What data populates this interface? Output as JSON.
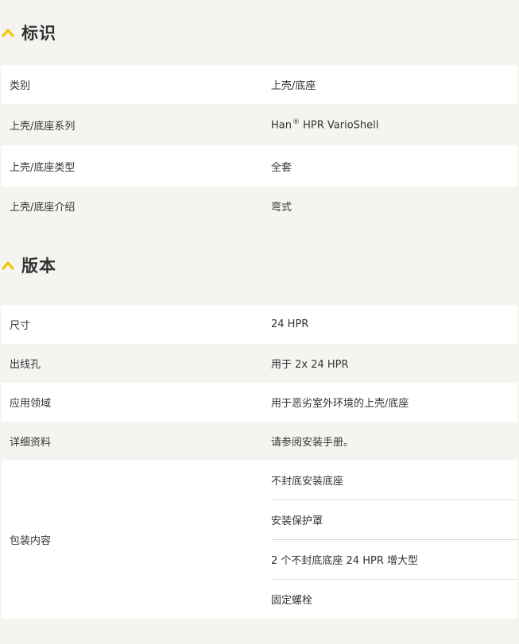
{
  "sections": {
    "identification": {
      "title": "标识",
      "rows": [
        {
          "label": "类别",
          "value": "上壳/底座"
        },
        {
          "label": "上壳/底座系列",
          "value": "Han",
          "value_suffix": "HPR VarioShell",
          "value_sup": "®"
        },
        {
          "label": "上壳/底座类型",
          "value": "全套"
        },
        {
          "label": "上壳/底座介绍",
          "value": "弯式"
        }
      ]
    },
    "version": {
      "title": "版本",
      "rows": [
        {
          "label": "尺寸",
          "value": "24 HPR"
        },
        {
          "label": "出线孔",
          "value": "用于 2x 24 HPR"
        },
        {
          "label": "应用领域",
          "value": "用于恶劣室外环境的上壳/底座"
        },
        {
          "label": "详细资料",
          "value": "请参阅安装手册。"
        }
      ],
      "package": {
        "label": "包装内容",
        "items": [
          "不封底安装底座",
          "安装保护罩",
          "2 个不封底底座 24 HPR 增大型",
          "固定螺栓"
        ]
      }
    }
  },
  "colors": {
    "accent": "#f5c400",
    "background": "#f5f4f1",
    "row_white": "#ffffff",
    "text": "#333333"
  },
  "icons": {
    "section_toggle": "chevron-up-icon"
  }
}
